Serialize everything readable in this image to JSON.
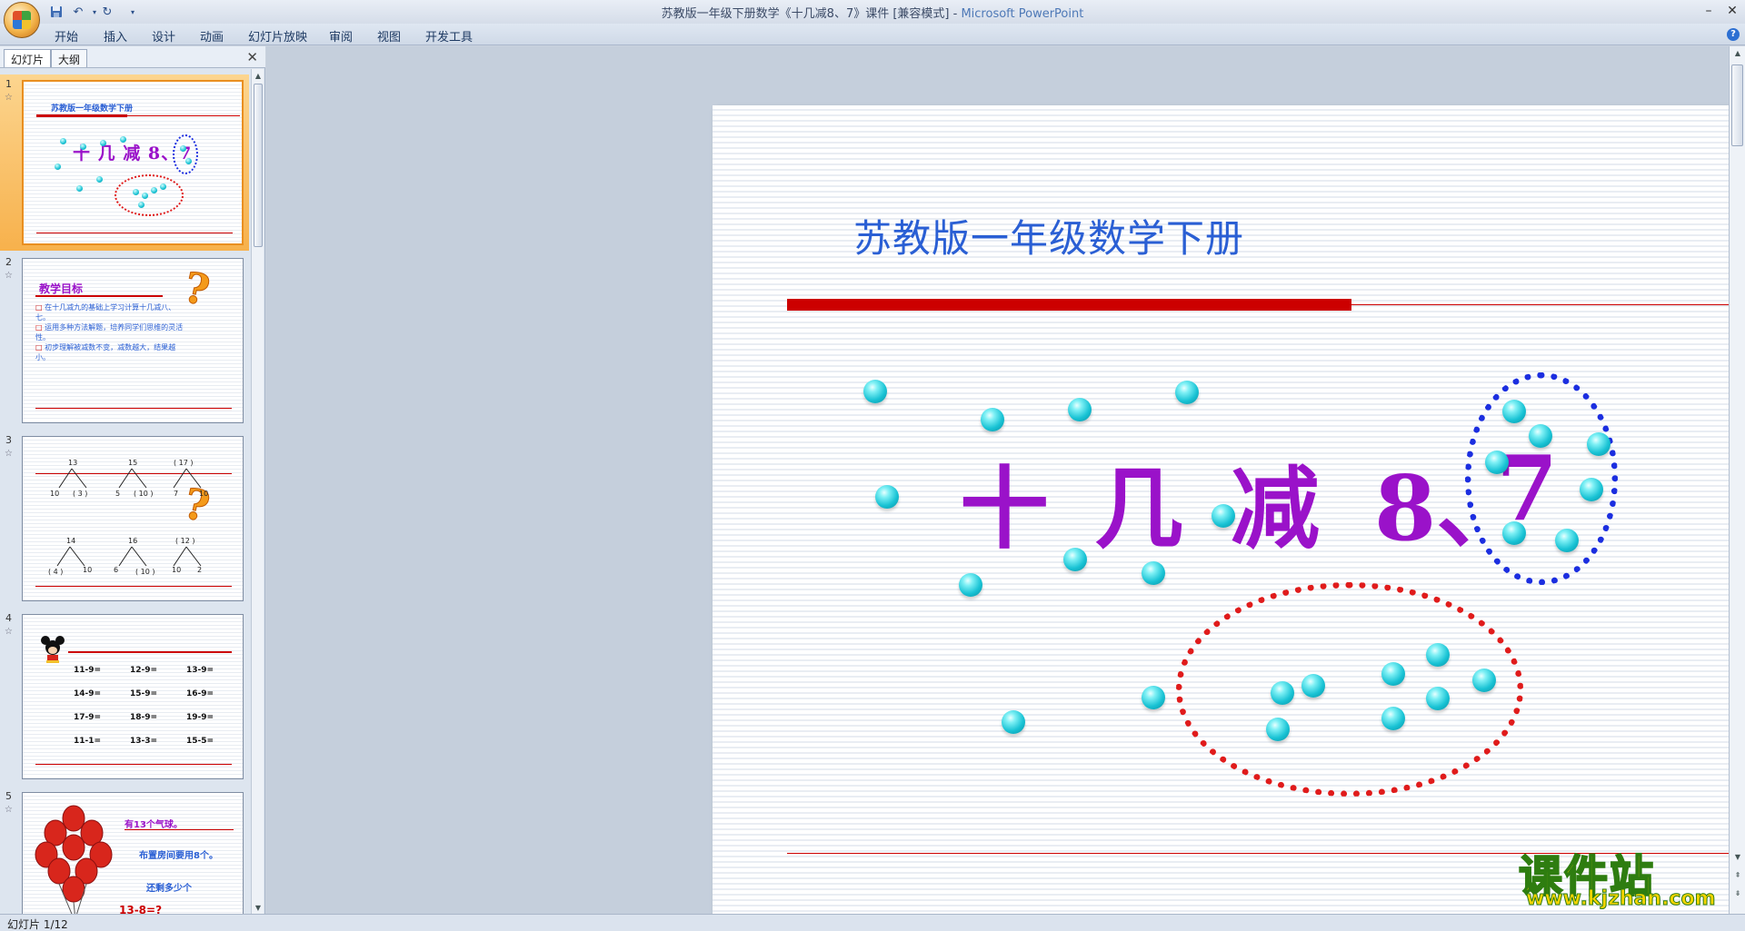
{
  "window": {
    "title": "苏教版一年级下册数学《十几减8、7》课件 [兼容模式] - ",
    "app_name": "Microsoft PowerPoint"
  },
  "quick_access": {
    "save_icon": "save-icon",
    "undo_icon": "undo-icon",
    "redo_icon": "redo-icon",
    "customize_icon": "dropdown-icon"
  },
  "ribbon": {
    "tabs": [
      "开始",
      "插入",
      "设计",
      "动画",
      "幻灯片放映",
      "审阅",
      "视图",
      "开发工具"
    ]
  },
  "left_panel": {
    "tabs": [
      "幻灯片",
      "大纲"
    ],
    "close_label": "✕"
  },
  "thumbnails": [
    {
      "number": "1",
      "header": "苏教版一年级数学下册",
      "title": "十 几 减 8、7"
    },
    {
      "number": "2",
      "heading": "教学目标",
      "bullets": [
        "在十几减九的基础上学习计算十几减八、七。",
        "运用多种方法解题，培养同学们思维的灵活性。",
        "初步理解被减数不变，减数越大，结果越小。"
      ]
    },
    {
      "number": "3",
      "trees_top": [
        {
          "top": "13",
          "left": "10",
          "right": "( 3 )"
        },
        {
          "top": "15",
          "left": "5",
          "right": "( 10 )"
        },
        {
          "top": "( 17 )",
          "left": "7",
          "right": "10"
        }
      ],
      "trees_bottom": [
        {
          "top": "14",
          "left": "( 4 )",
          "right": "10"
        },
        {
          "top": "16",
          "left": "6",
          "right": "( 10 )"
        },
        {
          "top": "( 12 )",
          "left": "10",
          "right": "2"
        }
      ]
    },
    {
      "number": "4",
      "equations": [
        [
          "11-9=",
          "12-9=",
          "13-9="
        ],
        [
          "14-9=",
          "15-9=",
          "16-9="
        ],
        [
          "17-9=",
          "18-9=",
          "19-9="
        ],
        [
          "11-1=",
          "13-3=",
          "15-5="
        ]
      ]
    },
    {
      "number": "5",
      "lines": [
        "有13个气球。",
        "布置房间要用8个。",
        "还剩多少个",
        "13-8=?"
      ]
    }
  ],
  "slide": {
    "header": "苏教版一年级数学下册",
    "title_chars": [
      "十",
      "几",
      "减",
      "8、",
      "7"
    ]
  },
  "status": {
    "text": "幻灯片 1/12"
  },
  "watermark": {
    "cn": "课件站",
    "url": "www.kjzhan.com"
  },
  "colors": {
    "accent_red": "#cc0000",
    "title_purple": "#9a12c9",
    "header_blue": "#2a5fd4",
    "ball_cyan": "#18c2d4",
    "selected_orange": "#f7b14c"
  }
}
